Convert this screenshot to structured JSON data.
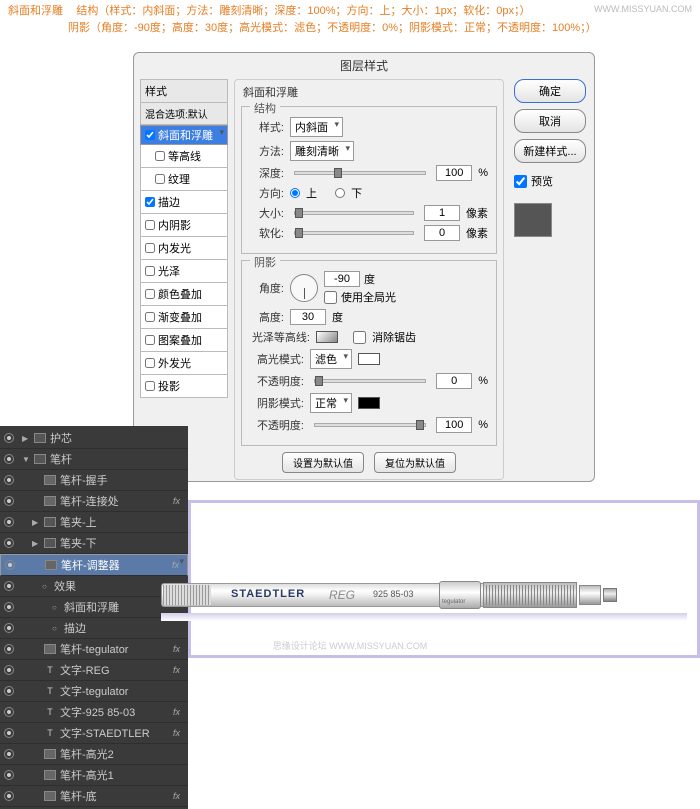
{
  "annotations": {
    "line1_prefix": "斜面和浮雕",
    "line1": "结构（样式：内斜面；方法：雕刻清晰；深度：100%；方向：上；大小：1px；软化：0px；）",
    "line2": "阴影（角度：-90度；高度：30度；高光模式：滤色；不透明度：0%；阴影模式：正常；不透明度：100%；）"
  },
  "watermark": "WWW.MISSYUAN.COM",
  "dialog": {
    "title": "图层样式",
    "styles_header": "样式",
    "blend_default": "混合选项:默认",
    "items": [
      {
        "label": "斜面和浮雕",
        "checked": true,
        "selected": true
      },
      {
        "label": "等高线",
        "checked": false,
        "indent": true
      },
      {
        "label": "纹理",
        "checked": false,
        "indent": true
      },
      {
        "label": "描边",
        "checked": true
      },
      {
        "label": "内阴影",
        "checked": false
      },
      {
        "label": "内发光",
        "checked": false
      },
      {
        "label": "光泽",
        "checked": false
      },
      {
        "label": "颜色叠加",
        "checked": false
      },
      {
        "label": "渐变叠加",
        "checked": false
      },
      {
        "label": "图案叠加",
        "checked": false
      },
      {
        "label": "外发光",
        "checked": false
      },
      {
        "label": "投影",
        "checked": false
      }
    ],
    "buttons": {
      "ok": "确定",
      "cancel": "取消",
      "new_style": "新建样式...",
      "preview": "预览"
    },
    "bevel": {
      "group1_title": "斜面和浮雕",
      "structure_title": "结构",
      "style_label": "样式:",
      "style_val": "内斜面",
      "method_label": "方法:",
      "method_val": "雕刻清晰",
      "depth_label": "深度:",
      "depth_val": "100",
      "pct": "%",
      "dir_label": "方向:",
      "dir_up": "上",
      "dir_down": "下",
      "size_label": "大小:",
      "size_val": "1",
      "px": "像素",
      "soften_label": "软化:",
      "soften_val": "0",
      "shade_title": "阴影",
      "angle_label": "角度:",
      "angle_val": "-90",
      "deg": "度",
      "global_label": "使用全局光",
      "alt_label": "高度:",
      "alt_val": "30",
      "gloss_label": "光泽等高线:",
      "aa_label": "消除锯齿",
      "hmode_label": "高光模式:",
      "hmode_val": "滤色",
      "hopac_label": "不透明度:",
      "hopac_val": "0",
      "smode_label": "阴影模式:",
      "smode_val": "正常",
      "sopac_label": "不透明度:",
      "sopac_val": "100",
      "set_default": "设置为默认值",
      "reset_default": "复位为默认值"
    }
  },
  "layers": {
    "rows": [
      {
        "label": "护芯",
        "type": "folder"
      },
      {
        "label": "笔杆",
        "type": "folder",
        "open": true
      },
      {
        "label": "笔杆-握手",
        "indent": 1
      },
      {
        "label": "笔杆-连接处",
        "indent": 1,
        "fx": true
      },
      {
        "label": "笔夹-上",
        "indent": 1,
        "type": "folder"
      },
      {
        "label": "笔夹-下",
        "indent": 1,
        "type": "folder"
      },
      {
        "label": "笔杆-调整器",
        "indent": 1,
        "fx": true,
        "selected": true
      },
      {
        "label": "效果",
        "indent": 2,
        "noicon": true
      },
      {
        "label": "斜面和浮雕",
        "indent": 3,
        "noicon": true
      },
      {
        "label": "描边",
        "indent": 3,
        "noicon": true
      },
      {
        "label": "笔杆-tegulator",
        "indent": 1,
        "fx": true
      },
      {
        "label": "文字-REG",
        "indent": 1,
        "type": "T",
        "fx": true
      },
      {
        "label": "文字-tegulator",
        "indent": 1,
        "type": "T"
      },
      {
        "label": "文字-925 85-03",
        "indent": 1,
        "type": "T",
        "fx": true
      },
      {
        "label": "文字-STAEDTLER",
        "indent": 1,
        "type": "T",
        "fx": true
      },
      {
        "label": "笔杆-高光2",
        "indent": 1
      },
      {
        "label": "笔杆-高光1",
        "indent": 1
      },
      {
        "label": "笔杆-底",
        "indent": 1,
        "fx": true
      }
    ],
    "fx": "fx"
  },
  "pencil": {
    "brand": "STAEDTLER",
    "reg": "REG",
    "model": "925 85-03",
    "teg": "tegulator"
  },
  "footer_wm": "思缘设计论坛   WWW.MISSYUAN.COM"
}
